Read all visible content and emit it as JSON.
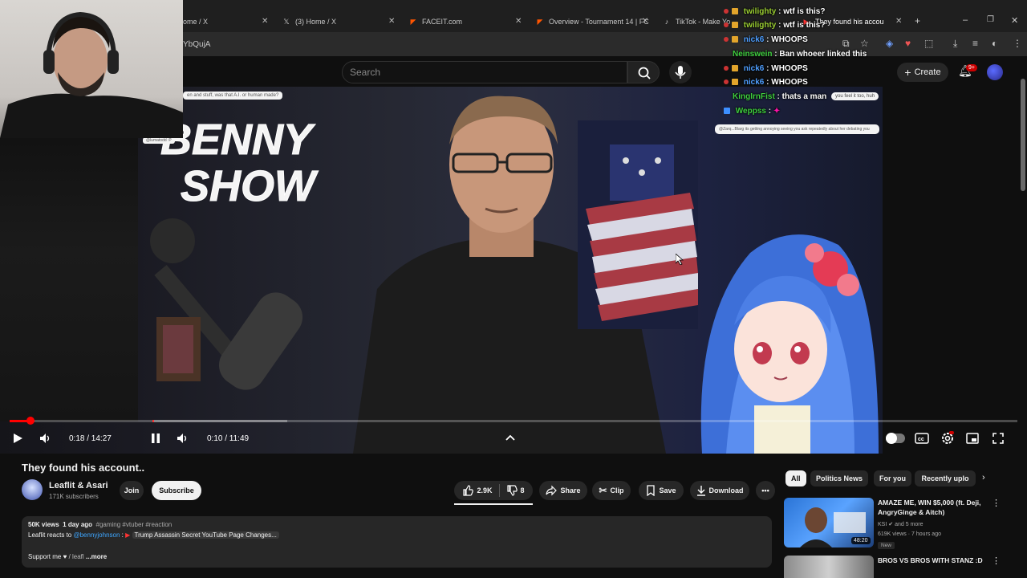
{
  "browser": {
    "tabs": [
      {
        "label": "ome / X",
        "icon": "x-logo-icon"
      },
      {
        "label": "(3) Home / X",
        "icon": "x-logo-icon"
      },
      {
        "label": "FACEIT.com",
        "icon": "faceit-icon"
      },
      {
        "label": "Overview - Tournament 14 | FC",
        "icon": "faceit-icon"
      },
      {
        "label": "TikTok - Make Yo",
        "icon": "tiktok-icon"
      },
      {
        "label": "They found his accou",
        "icon": "youtube-icon"
      }
    ],
    "address": "YbQujA"
  },
  "youtube": {
    "search_placeholder": "Search",
    "create_label": "Create",
    "notif_badge": "9+"
  },
  "video": {
    "overlay_note_top": "en and stuff, was that A.I. or human made?",
    "overlay_note_small": "@lumatodd :P",
    "logo_line1": "BENNY",
    "logo_line2": "SHOW"
  },
  "chat": [
    {
      "user": "twilighty",
      "msg": "wtf is this?",
      "color": "#9acd32"
    },
    {
      "user": "twilighty",
      "msg": "wtf is this?",
      "color": "#9acd32"
    },
    {
      "user": "nick6",
      "msg": "WHOOPS",
      "color": "#4f9fff"
    },
    {
      "user": "Neinswein",
      "msg": "Ban whoeer linked this",
      "color": "#3fcf3f"
    },
    {
      "user": "nick6",
      "msg": "WHOOPS",
      "color": "#4f9fff"
    },
    {
      "user": "nick6",
      "msg": "WHOOPS",
      "color": "#4f9fff"
    },
    {
      "user": "KingIrnFist",
      "msg": "thats a man",
      "color": "#3fcf3f"
    },
    {
      "user": "Weppss",
      "msg": "",
      "color": "#3fcf3f"
    }
  ],
  "chat_bubbles": {
    "b1": "you feel it too, huh",
    "b2": "@Zarq...Blarg its getting annoying seeing you ask repeatedly about her debating you"
  },
  "player": {
    "outer_time": "0:18 / 14:27",
    "inner_time": "0:10 / 11:49",
    "outer_progress": 0.021,
    "inner_progress": 0.014
  },
  "meta": {
    "title": "They found his account..",
    "channel": "Leaflit & Asari",
    "subscribers": "171K subscribers",
    "join": "Join",
    "subscribe": "Subscribe",
    "likes": "2.9K",
    "dislikes": "8",
    "share": "Share",
    "clip": "Clip",
    "save": "Save",
    "download": "Download"
  },
  "description": {
    "views": "50K views",
    "age": "1 day ago",
    "tags": "#gaming #vtuber #reaction",
    "line2_prefix": "Leaflit reacts to",
    "line2_mention": "@bennyjohnson",
    "line2_suffix": "Trump Assassin Secret YouTube Page Changes...",
    "line3": "Support me ♥",
    "line3_link": "/ leafl",
    "more": "...more"
  },
  "chips": [
    "All",
    "Politics News",
    "For you",
    "Recently uplo"
  ],
  "related": [
    {
      "title": "AMAZE ME, WIN $5,000 (ft. Deji, AngryGinge & Aitch)",
      "channel": "KSI",
      "extra": "and 5 more",
      "meta": "619K views · 7 hours ago",
      "badge": "New",
      "duration": "48:20"
    },
    {
      "title": "BROS VS BROS WITH STANZ :D"
    }
  ]
}
